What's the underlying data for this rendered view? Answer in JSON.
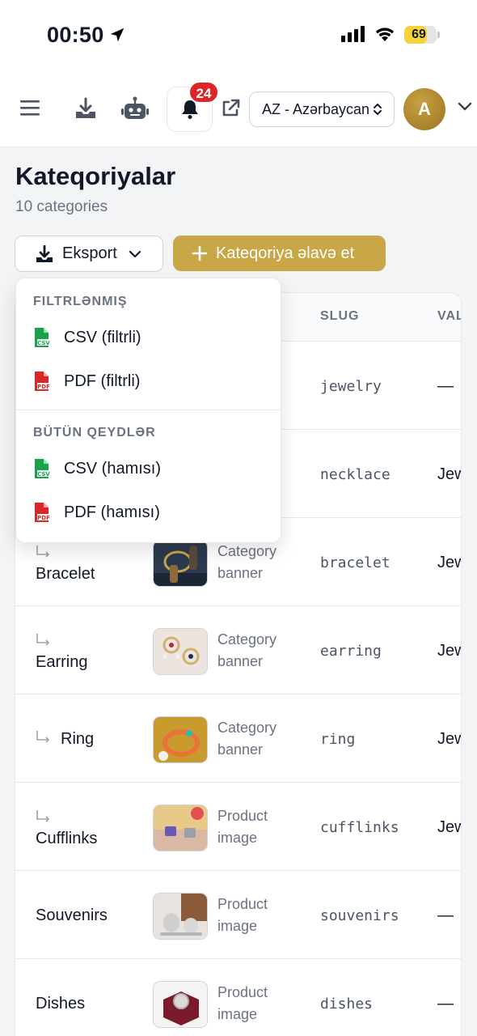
{
  "status_bar": {
    "time": "00:50",
    "battery": "69",
    "battery_level": 0.69
  },
  "header": {
    "notification_count": "24",
    "language": "AZ - Azərbaycan",
    "avatar_initial": "A"
  },
  "page": {
    "title": "Kateqoriyalar",
    "subtitle": "10 categories",
    "export_label": "Eksport",
    "add_label": "Kateqoriya əlavə et"
  },
  "table": {
    "columns": [
      "SLUG",
      "VALİDEYN"
    ],
    "rows": [
      {
        "name": "",
        "image_label": "",
        "slug": "jewelry",
        "parent": "—"
      },
      {
        "name": "",
        "image_label": "",
        "slug": "necklace",
        "parent": "Jewelry"
      },
      {
        "name": "Bracelet",
        "image_label": "Category banner",
        "slug": "bracelet",
        "parent": "Jewelry"
      },
      {
        "name": "Earring",
        "image_label": "Category banner",
        "slug": "earring",
        "parent": "Jewelry"
      },
      {
        "name": "Ring",
        "image_label": "Category banner",
        "slug": "ring",
        "parent": "Jewelry"
      },
      {
        "name": "Cufflinks",
        "image_label": "Product image",
        "slug": "cufflinks",
        "parent": "Jewelry"
      },
      {
        "name": "Souvenirs",
        "image_label": "Product image",
        "slug": "souvenirs",
        "parent": "—"
      },
      {
        "name": "Dishes",
        "image_label": "Product image",
        "slug": "dishes",
        "parent": "—"
      }
    ]
  },
  "export_menu": {
    "filtered_heading": "FILTRLƏNMIŞ",
    "csv_filtered": "CSV (filtrli)",
    "pdf_filtered": "PDF (filtrli)",
    "all_heading": "BÜTÜN QEYDLƏR",
    "csv_all": "CSV (hamısı)",
    "pdf_all": "PDF (hamısı)",
    "csv_icon_text": "CSV",
    "pdf_icon_text": "PDF"
  },
  "colors": {
    "accent": "#c9a646",
    "badge": "#dc2626",
    "csv": "#16a34a",
    "pdf": "#dc2626"
  }
}
